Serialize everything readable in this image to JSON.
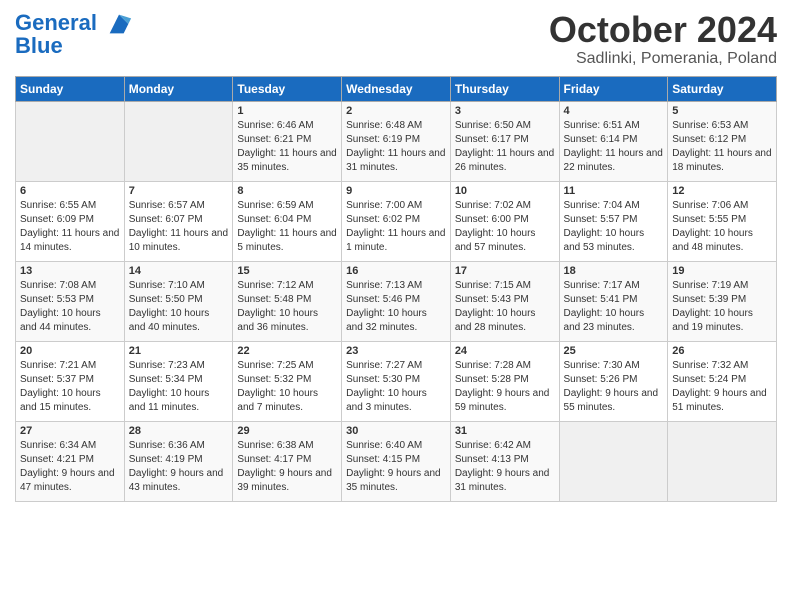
{
  "header": {
    "logo_line1": "General",
    "logo_line2": "Blue",
    "month_title": "October 2024",
    "location": "Sadlinki, Pomerania, Poland"
  },
  "days_of_week": [
    "Sunday",
    "Monday",
    "Tuesday",
    "Wednesday",
    "Thursday",
    "Friday",
    "Saturday"
  ],
  "weeks": [
    [
      {
        "day": "",
        "sunrise": "",
        "sunset": "",
        "daylight": ""
      },
      {
        "day": "",
        "sunrise": "",
        "sunset": "",
        "daylight": ""
      },
      {
        "day": "1",
        "sunrise": "Sunrise: 6:46 AM",
        "sunset": "Sunset: 6:21 PM",
        "daylight": "Daylight: 11 hours and 35 minutes."
      },
      {
        "day": "2",
        "sunrise": "Sunrise: 6:48 AM",
        "sunset": "Sunset: 6:19 PM",
        "daylight": "Daylight: 11 hours and 31 minutes."
      },
      {
        "day": "3",
        "sunrise": "Sunrise: 6:50 AM",
        "sunset": "Sunset: 6:17 PM",
        "daylight": "Daylight: 11 hours and 26 minutes."
      },
      {
        "day": "4",
        "sunrise": "Sunrise: 6:51 AM",
        "sunset": "Sunset: 6:14 PM",
        "daylight": "Daylight: 11 hours and 22 minutes."
      },
      {
        "day": "5",
        "sunrise": "Sunrise: 6:53 AM",
        "sunset": "Sunset: 6:12 PM",
        "daylight": "Daylight: 11 hours and 18 minutes."
      }
    ],
    [
      {
        "day": "6",
        "sunrise": "Sunrise: 6:55 AM",
        "sunset": "Sunset: 6:09 PM",
        "daylight": "Daylight: 11 hours and 14 minutes."
      },
      {
        "day": "7",
        "sunrise": "Sunrise: 6:57 AM",
        "sunset": "Sunset: 6:07 PM",
        "daylight": "Daylight: 11 hours and 10 minutes."
      },
      {
        "day": "8",
        "sunrise": "Sunrise: 6:59 AM",
        "sunset": "Sunset: 6:04 PM",
        "daylight": "Daylight: 11 hours and 5 minutes."
      },
      {
        "day": "9",
        "sunrise": "Sunrise: 7:00 AM",
        "sunset": "Sunset: 6:02 PM",
        "daylight": "Daylight: 11 hours and 1 minute."
      },
      {
        "day": "10",
        "sunrise": "Sunrise: 7:02 AM",
        "sunset": "Sunset: 6:00 PM",
        "daylight": "Daylight: 10 hours and 57 minutes."
      },
      {
        "day": "11",
        "sunrise": "Sunrise: 7:04 AM",
        "sunset": "Sunset: 5:57 PM",
        "daylight": "Daylight: 10 hours and 53 minutes."
      },
      {
        "day": "12",
        "sunrise": "Sunrise: 7:06 AM",
        "sunset": "Sunset: 5:55 PM",
        "daylight": "Daylight: 10 hours and 48 minutes."
      }
    ],
    [
      {
        "day": "13",
        "sunrise": "Sunrise: 7:08 AM",
        "sunset": "Sunset: 5:53 PM",
        "daylight": "Daylight: 10 hours and 44 minutes."
      },
      {
        "day": "14",
        "sunrise": "Sunrise: 7:10 AM",
        "sunset": "Sunset: 5:50 PM",
        "daylight": "Daylight: 10 hours and 40 minutes."
      },
      {
        "day": "15",
        "sunrise": "Sunrise: 7:12 AM",
        "sunset": "Sunset: 5:48 PM",
        "daylight": "Daylight: 10 hours and 36 minutes."
      },
      {
        "day": "16",
        "sunrise": "Sunrise: 7:13 AM",
        "sunset": "Sunset: 5:46 PM",
        "daylight": "Daylight: 10 hours and 32 minutes."
      },
      {
        "day": "17",
        "sunrise": "Sunrise: 7:15 AM",
        "sunset": "Sunset: 5:43 PM",
        "daylight": "Daylight: 10 hours and 28 minutes."
      },
      {
        "day": "18",
        "sunrise": "Sunrise: 7:17 AM",
        "sunset": "Sunset: 5:41 PM",
        "daylight": "Daylight: 10 hours and 23 minutes."
      },
      {
        "day": "19",
        "sunrise": "Sunrise: 7:19 AM",
        "sunset": "Sunset: 5:39 PM",
        "daylight": "Daylight: 10 hours and 19 minutes."
      }
    ],
    [
      {
        "day": "20",
        "sunrise": "Sunrise: 7:21 AM",
        "sunset": "Sunset: 5:37 PM",
        "daylight": "Daylight: 10 hours and 15 minutes."
      },
      {
        "day": "21",
        "sunrise": "Sunrise: 7:23 AM",
        "sunset": "Sunset: 5:34 PM",
        "daylight": "Daylight: 10 hours and 11 minutes."
      },
      {
        "day": "22",
        "sunrise": "Sunrise: 7:25 AM",
        "sunset": "Sunset: 5:32 PM",
        "daylight": "Daylight: 10 hours and 7 minutes."
      },
      {
        "day": "23",
        "sunrise": "Sunrise: 7:27 AM",
        "sunset": "Sunset: 5:30 PM",
        "daylight": "Daylight: 10 hours and 3 minutes."
      },
      {
        "day": "24",
        "sunrise": "Sunrise: 7:28 AM",
        "sunset": "Sunset: 5:28 PM",
        "daylight": "Daylight: 9 hours and 59 minutes."
      },
      {
        "day": "25",
        "sunrise": "Sunrise: 7:30 AM",
        "sunset": "Sunset: 5:26 PM",
        "daylight": "Daylight: 9 hours and 55 minutes."
      },
      {
        "day": "26",
        "sunrise": "Sunrise: 7:32 AM",
        "sunset": "Sunset: 5:24 PM",
        "daylight": "Daylight: 9 hours and 51 minutes."
      }
    ],
    [
      {
        "day": "27",
        "sunrise": "Sunrise: 6:34 AM",
        "sunset": "Sunset: 4:21 PM",
        "daylight": "Daylight: 9 hours and 47 minutes."
      },
      {
        "day": "28",
        "sunrise": "Sunrise: 6:36 AM",
        "sunset": "Sunset: 4:19 PM",
        "daylight": "Daylight: 9 hours and 43 minutes."
      },
      {
        "day": "29",
        "sunrise": "Sunrise: 6:38 AM",
        "sunset": "Sunset: 4:17 PM",
        "daylight": "Daylight: 9 hours and 39 minutes."
      },
      {
        "day": "30",
        "sunrise": "Sunrise: 6:40 AM",
        "sunset": "Sunset: 4:15 PM",
        "daylight": "Daylight: 9 hours and 35 minutes."
      },
      {
        "day": "31",
        "sunrise": "Sunrise: 6:42 AM",
        "sunset": "Sunset: 4:13 PM",
        "daylight": "Daylight: 9 hours and 31 minutes."
      },
      {
        "day": "",
        "sunrise": "",
        "sunset": "",
        "daylight": ""
      },
      {
        "day": "",
        "sunrise": "",
        "sunset": "",
        "daylight": ""
      }
    ]
  ]
}
